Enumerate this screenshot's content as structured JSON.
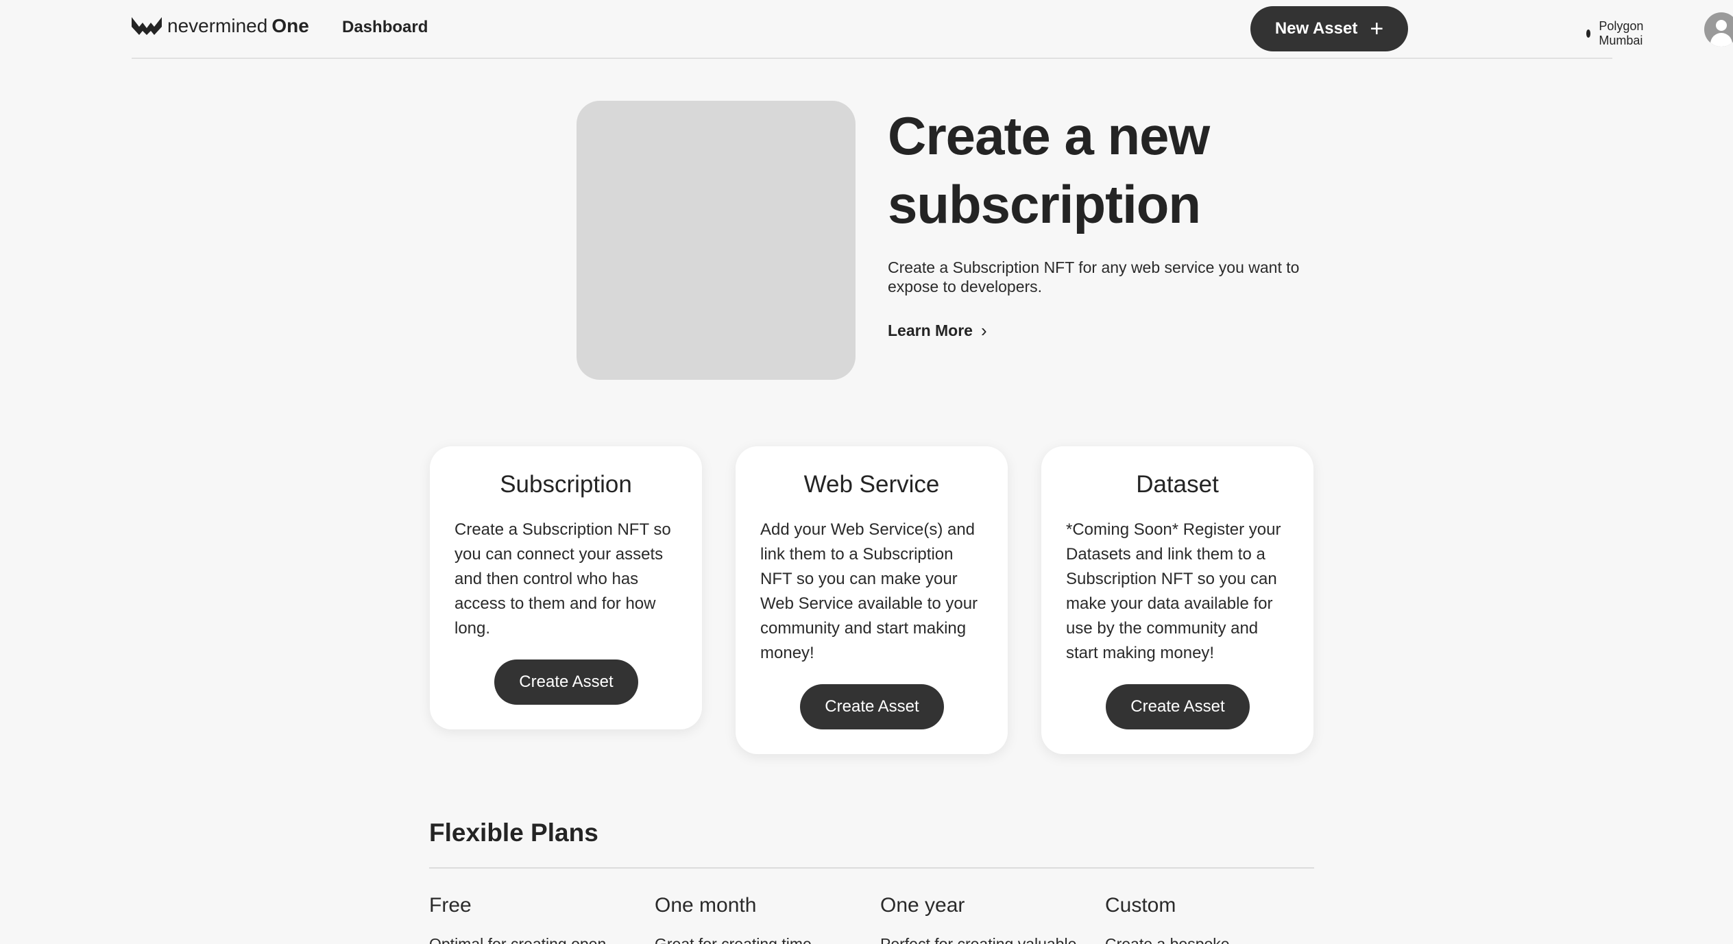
{
  "header": {
    "logo_text": "nevermined",
    "logo_bold": "One",
    "nav_dashboard": "Dashboard",
    "new_asset_label": "New Asset",
    "new_asset_icon": "+",
    "network_label": "Polygon Mumbai"
  },
  "hero": {
    "title_line1": "Create a new",
    "title_line2": "subscription",
    "description": "Create a Subscription NFT for any web service you want to expose to developers.",
    "learn_more": "Learn More",
    "learn_more_icon": "›"
  },
  "cards": [
    {
      "title": "Subscription",
      "text": "Create a Subscription NFT so you can connect your assets and then control who has access to them and for how long.",
      "button": "Create Asset"
    },
    {
      "title": "Web Service",
      "text": "Add your Web Service(s) and link them to a Subscription NFT so you can make your Web Service available to your community and start making money!",
      "button": "Create Asset"
    },
    {
      "title": "Dataset",
      "text": "*Coming Soon* Register your Datasets and link them to a Subscription NFT so you can make your data available for use by the community and start making money!",
      "button": "Create Asset"
    }
  ],
  "plans": {
    "title": "Flexible Plans",
    "items": [
      {
        "name": "Free",
        "desc": "Optimal for creating open"
      },
      {
        "name": "One month",
        "desc": "Great for creating time"
      },
      {
        "name": "One year",
        "desc": "Perfect for creating valuable"
      },
      {
        "name": "Custom",
        "desc": "Create a bespoke"
      }
    ]
  }
}
